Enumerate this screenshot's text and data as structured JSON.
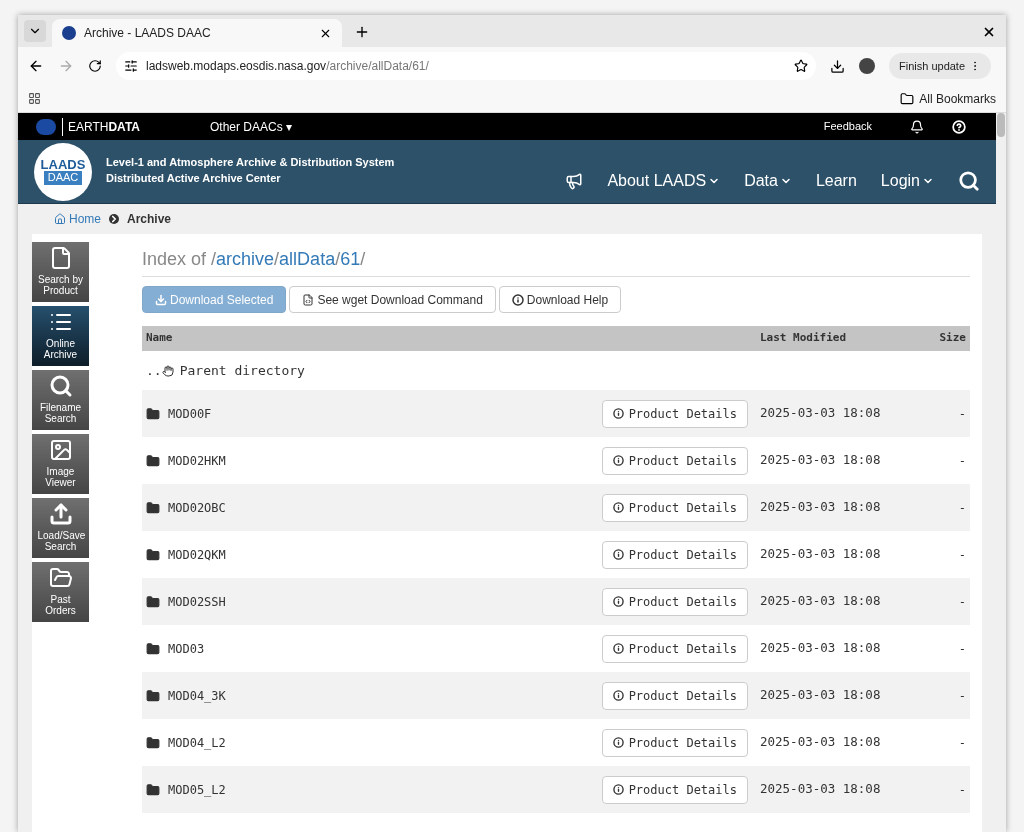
{
  "browser": {
    "tab_title": "Archive - LAADS DAAC",
    "url_host": "ladsweb.modaps.eosdis.nasa.gov",
    "url_path": "/archive/allData/61/",
    "update_button": "Finish update",
    "bookmarks": "All Bookmarks"
  },
  "earthdata_bar": {
    "brand_light": "EARTH",
    "brand_bold": "DATA",
    "other_daacs": "Other DAACs ▾",
    "feedback": "Feedback"
  },
  "header": {
    "logo_top": "LAADS",
    "logo_bottom": "DAAC",
    "title_line1": "Level-1 and Atmosphere Archive & Distribution System",
    "title_line2": "Distributed Active Archive Center",
    "nav": [
      {
        "label": "About LAADS",
        "dropdown": true
      },
      {
        "label": "Data",
        "dropdown": true
      },
      {
        "label": "Learn",
        "dropdown": false
      },
      {
        "label": "Login",
        "dropdown": true
      }
    ]
  },
  "breadcrumb": [
    {
      "label": "Home",
      "link": true
    },
    {
      "label": "Archive",
      "link": false
    }
  ],
  "sidebar": [
    {
      "label": "Search by Product",
      "kind": "file",
      "selected": false
    },
    {
      "label": "Online Archive",
      "kind": "list",
      "selected": true
    },
    {
      "label": "Filename Search",
      "kind": "search",
      "selected": false
    },
    {
      "label": "Image Viewer",
      "kind": "image",
      "selected": false
    },
    {
      "label": "Load/Save Search",
      "kind": "upload",
      "selected": false
    },
    {
      "label": "Past Orders",
      "kind": "folder",
      "selected": false
    }
  ],
  "index": [
    {
      "text": "Index of /",
      "link": false
    },
    {
      "text": "archive",
      "link": true
    },
    {
      "text": "/",
      "link": false
    },
    {
      "text": "allData",
      "link": true
    },
    {
      "text": "/",
      "link": false
    },
    {
      "text": "61",
      "link": true
    },
    {
      "text": "/",
      "link": false
    }
  ],
  "actions": [
    {
      "label": "Download Selected",
      "kind": "primary",
      "disabled": true
    },
    {
      "label": "See wget Download Command",
      "kind": "wget",
      "disabled": false
    },
    {
      "label": "Download Help",
      "kind": "help",
      "disabled": false
    }
  ],
  "table": {
    "columns": [
      "Name",
      "Last Modified",
      "Size"
    ],
    "parent": "Parent directory",
    "parent_dots": "..",
    "rows": [
      {
        "name": "MOD00F",
        "details": "Product Details",
        "modified": "2025-03-03 18:08",
        "size": "-"
      },
      {
        "name": "MOD02HKM",
        "details": "Product Details",
        "modified": "2025-03-03 18:08",
        "size": "-"
      },
      {
        "name": "MOD02OBC",
        "details": "Product Details",
        "modified": "2025-03-03 18:08",
        "size": "-"
      },
      {
        "name": "MOD02QKM",
        "details": "Product Details",
        "modified": "2025-03-03 18:08",
        "size": "-"
      },
      {
        "name": "MOD02SSH",
        "details": "Product Details",
        "modified": "2025-03-03 18:08",
        "size": "-"
      },
      {
        "name": "MOD03",
        "details": "Product Details",
        "modified": "2025-03-03 18:08",
        "size": "-"
      },
      {
        "name": "MOD04_3K",
        "details": "Product Details",
        "modified": "2025-03-03 18:08",
        "size": "-"
      },
      {
        "name": "MOD04_L2",
        "details": "Product Details",
        "modified": "2025-03-03 18:08",
        "size": "-"
      },
      {
        "name": "MOD05_L2",
        "details": "Product Details",
        "modified": "2025-03-03 18:08",
        "size": "-"
      }
    ]
  }
}
